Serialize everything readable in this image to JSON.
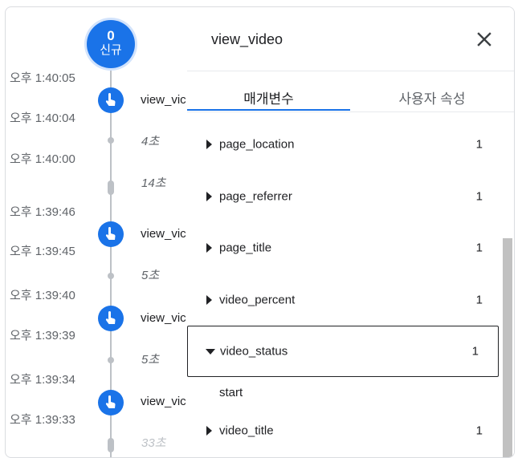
{
  "timeline": {
    "new_badge": {
      "count": "0",
      "label": "신규"
    },
    "times": [
      "오후 1:40:05",
      "오후 1:40:04",
      "오후 1:40:00",
      "오후 1:39:46",
      "오후 1:39:45",
      "오후 1:39:40",
      "오후 1:39:39",
      "오후 1:39:34",
      "오후 1:39:33"
    ],
    "events": [
      {
        "label": "view_vic"
      },
      {
        "label": "view_vic"
      },
      {
        "label": "view_vic"
      },
      {
        "label": "view_vic"
      }
    ],
    "durations": [
      "4초",
      "14초",
      "5초",
      "5초",
      "33초"
    ]
  },
  "panel": {
    "title": "view_video",
    "close_icon": "close-icon",
    "tabs": {
      "params": "매개변수",
      "user_props": "사용자 속성"
    },
    "params": [
      {
        "name": "page_location",
        "count": "1"
      },
      {
        "name": "page_referrer",
        "count": "1"
      },
      {
        "name": "page_title",
        "count": "1"
      },
      {
        "name": "video_percent",
        "count": "1"
      },
      {
        "name": "video_status",
        "count": "1",
        "value": "start"
      },
      {
        "name": "video_title",
        "count": "1"
      }
    ]
  },
  "colors": {
    "accent": "#1a73e8",
    "line": "#bdc1c6",
    "muted": "#5f6368"
  }
}
